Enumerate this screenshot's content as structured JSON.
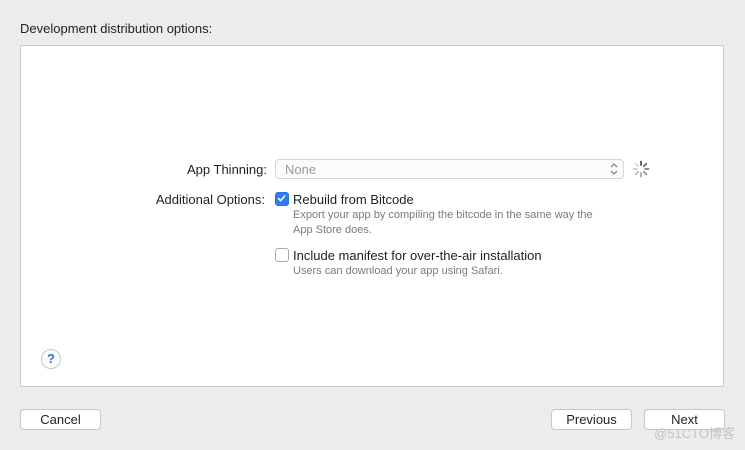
{
  "header": {
    "title": "Development distribution options:"
  },
  "options": {
    "app_thinning_label": "App Thinning:",
    "app_thinning_value": "None",
    "additional_options_label": "Additional Options:",
    "rebuild": {
      "label": "Rebuild from Bitcode",
      "checked": true,
      "desc_line1": "Export your app by compiling the bitcode in the same way the",
      "desc_line2": "App Store does."
    },
    "manifest": {
      "label": "Include manifest for over-the-air installation",
      "checked": false,
      "desc": "Users can download your app using Safari."
    }
  },
  "help": {
    "label": "?"
  },
  "footer": {
    "cancel_label": "Cancel",
    "previous_label": "Previous",
    "next_label": "Next"
  },
  "watermark": "@51CTO博客",
  "colors": {
    "accent": "#2f7df6",
    "help": "#2f6fe0"
  },
  "icons": {
    "spinner": "loading-spinner-icon",
    "select": "stepper-arrows-icon",
    "check": "checkmark-icon",
    "help": "question-mark-icon"
  }
}
